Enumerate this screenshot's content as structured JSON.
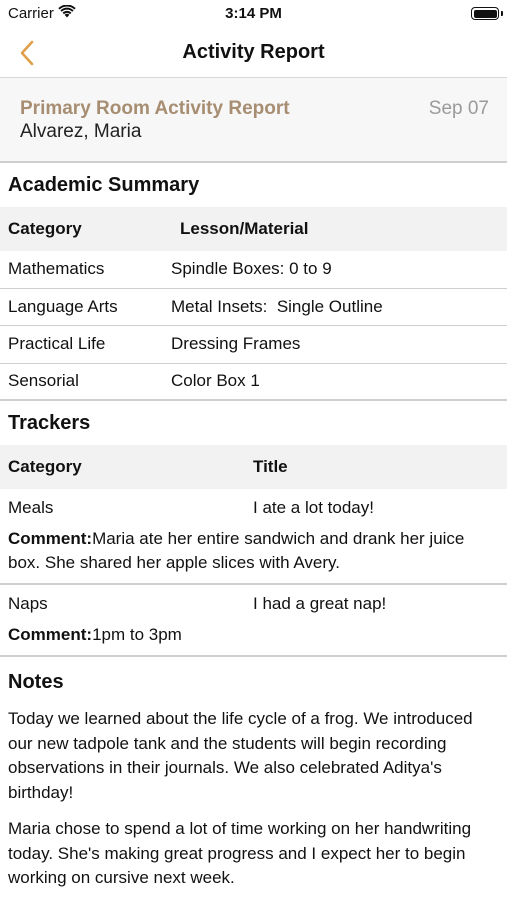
{
  "status_bar": {
    "carrier": "Carrier",
    "time": "3:14 PM",
    "icons": [
      "wifi-icon",
      "battery-icon"
    ]
  },
  "nav": {
    "title": "Activity Report",
    "back_icon": "chevron-left-icon",
    "accent_color": "#e0a04b"
  },
  "report": {
    "title": "Primary Room Activity Report",
    "date": "Sep 07",
    "student": "Alvarez, Maria",
    "title_color": "#a78e72"
  },
  "academic": {
    "title": "Academic Summary",
    "headers": [
      "Category",
      "Lesson/Material"
    ],
    "rows": [
      {
        "category": "Mathematics",
        "lesson": "Spindle Boxes: 0 to 9"
      },
      {
        "category": "Language Arts",
        "lesson": "Metal Insets:  Single Outline"
      },
      {
        "category": "Practical Life",
        "lesson": "Dressing Frames"
      },
      {
        "category": "Sensorial",
        "lesson": "Color Box 1"
      }
    ]
  },
  "trackers": {
    "title": "Trackers",
    "headers": [
      "Category",
      "Title"
    ],
    "comment_label": "Comment:",
    "items": [
      {
        "category": "Meals",
        "title": "I ate a lot today!",
        "comment": "Maria ate her entire sandwich and drank her juice box. She shared her apple slices with Avery."
      },
      {
        "category": "Naps",
        "title": "I had a great nap!",
        "comment": "1pm to 3pm"
      }
    ]
  },
  "notes": {
    "title": "Notes",
    "paragraphs": [
      "Today we learned about the life cycle of a frog. We introduced our new tadpole tank and the students will begin recording observations in their journals. We also celebrated Aditya's birthday!",
      "Maria chose to spend a lot of time working on her handwriting today. She's making great progress and I expect her to begin working on cursive next week."
    ]
  }
}
